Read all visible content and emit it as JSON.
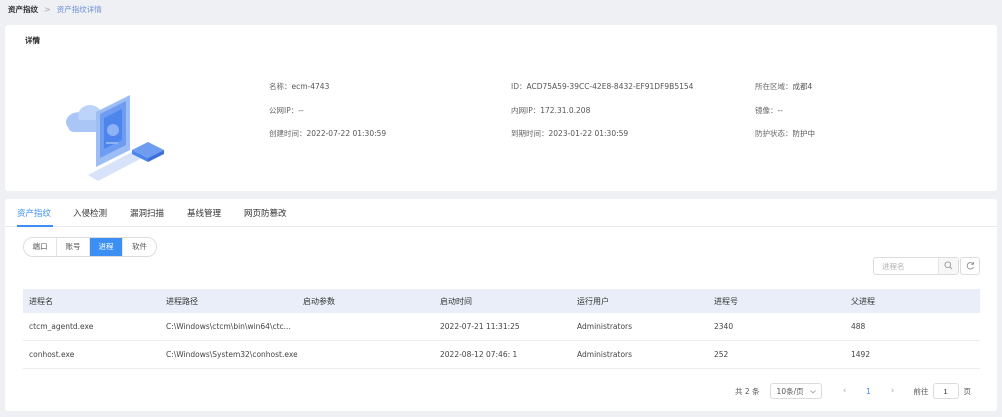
{
  "breadcrumb": {
    "root": "资产指纹",
    "separator": ">",
    "current": "资产指纹详情"
  },
  "detail": {
    "title": "详情",
    "fields": {
      "name": {
        "label": "名称：",
        "value": "ecm-4743"
      },
      "id": {
        "label": "ID：",
        "value": "ACD75A59-39CC-42E8-8432-EF91DF9B5154"
      },
      "region": {
        "label": "所在区域：",
        "value": "成都4"
      },
      "public_ip": {
        "label": "公网IP：",
        "value": "--"
      },
      "private_ip": {
        "label": "内网IP：",
        "value": "172.31.0.208"
      },
      "image": {
        "label": "镜像：",
        "value": "--"
      },
      "created": {
        "label": "创建时间：",
        "value": "2022-07-22 01:30:59"
      },
      "expires": {
        "label": "到期时间：",
        "value": "2023-01-22 01:30:59"
      },
      "protection": {
        "label": "防护状态：",
        "value": "防护中"
      }
    }
  },
  "tabs": [
    {
      "label": "资产指纹",
      "active": true
    },
    {
      "label": "入侵检测"
    },
    {
      "label": "漏洞扫描"
    },
    {
      "label": "基线管理"
    },
    {
      "label": "网页防篡改"
    }
  ],
  "segments": [
    {
      "label": "端口"
    },
    {
      "label": "账号"
    },
    {
      "label": "进程",
      "active": true
    },
    {
      "label": "软件"
    }
  ],
  "search": {
    "placeholder": "进程名",
    "value": ""
  },
  "table": {
    "columns": [
      "进程名",
      "进程路径",
      "启动参数",
      "启动时间",
      "运行用户",
      "进程号",
      "父进程"
    ],
    "rows": [
      [
        "ctcm_agentd.exe",
        "C:\\Windows\\ctcm\\bin\\win64\\ctc...",
        "",
        "2022-07-21 11:31:25",
        "Administrators",
        "2340",
        "488"
      ],
      [
        "conhost.exe",
        "C:\\Windows\\System32\\conhost.exe",
        "",
        "2022-08-12 07:46: 1",
        "Administrators",
        "252",
        "1492"
      ]
    ]
  },
  "pagination": {
    "total": "共 2 条",
    "page_size": "10条/页",
    "current_page": "1",
    "goto_label": "前往",
    "goto_value": "1",
    "page_suffix": "页"
  },
  "colors": {
    "accent": "#3d8ff3",
    "table_header_bg": "#e9eef8",
    "page_bg": "#eef0f4"
  }
}
